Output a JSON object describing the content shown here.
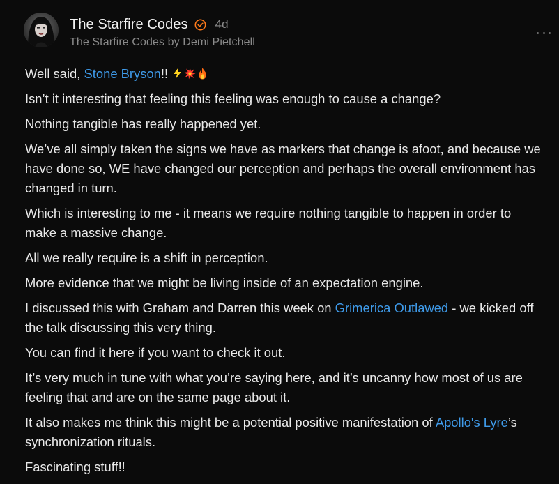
{
  "post": {
    "author_name": "The Starfire Codes",
    "time_ago": "4d",
    "publication": "The Starfire Codes by Demi Pietchell"
  },
  "icons": {
    "avatar": "avatar-photo",
    "verified": "verified-check-icon",
    "more": "more-options-icon",
    "emojis": [
      "lightning-icon",
      "collision-icon",
      "fire-icon"
    ]
  },
  "colors": {
    "background": "#0b0b0b",
    "text": "#e8e8e8",
    "muted": "#8a8a8a",
    "link": "#3f9bea",
    "verified": "#ff7a1a"
  },
  "content": {
    "p1": {
      "before": "Well said, ",
      "link": "Stone Bryson",
      "after": "!! "
    },
    "p2": "Isn’t it interesting that feeling this feeling was enough to cause a change?",
    "p3": "Nothing tangible has really happened yet.",
    "p4": "We’ve all simply taken the signs we have as markers that change is afoot, and because we have done so, WE have changed our perception and perhaps the overall environment has changed in turn.",
    "p5": "Which is interesting to me - it means we require nothing tangible to happen in order to make a massive change.",
    "p6": "All we really require is a shift in perception.",
    "p7": "More evidence that we might be living inside of an expectation engine.",
    "p8": {
      "before": "I discussed this with Graham and Darren this week on ",
      "link": "Grimerica Outlawed",
      "after": " - we kicked off the talk discussing this very thing."
    },
    "p9": "You can find it here if you want to check it out.",
    "p10": "It’s very much in tune with what you’re saying here, and it’s uncanny how most of us are feeling that and are on the same page about it.",
    "p11": {
      "before": "It also makes me think this might be a potential positive manifestation of ",
      "link": "Apollo's Lyre",
      "after": "’s synchronization rituals."
    },
    "p12": "Fascinating stuff!!"
  }
}
